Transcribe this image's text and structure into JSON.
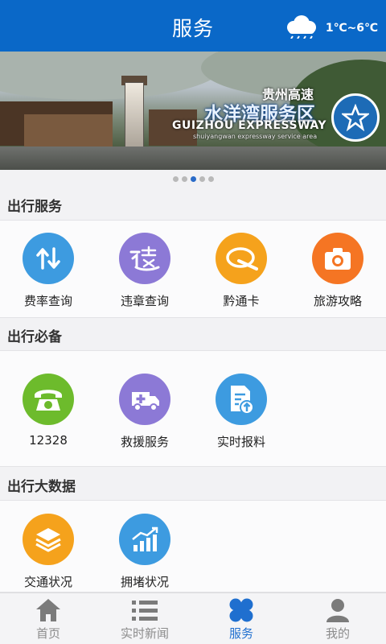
{
  "header": {
    "title": "服务",
    "weather_icon": "cloud-rain-icon",
    "temperature": "1℃~6℃"
  },
  "banner": {
    "line1": "贵州高速",
    "line2": "水洋湾服务区",
    "line3": "GUIZHOU EXPRESSWAY",
    "line4": "shuiyangwan expressway service area",
    "slide_index": 3,
    "slide_count": 5
  },
  "sections": [
    {
      "title": "出行服务",
      "items": [
        {
          "label": "费率查询",
          "icon": "swap-arrows-icon",
          "color": "#3d9be0"
        },
        {
          "label": "违章查询",
          "icon": "violation-icon",
          "color": "#8c79d6"
        },
        {
          "label": "黔通卡",
          "icon": "q-card-icon",
          "color": "#f5a21c"
        },
        {
          "label": "旅游攻略",
          "icon": "camera-icon",
          "color": "#f57523"
        }
      ]
    },
    {
      "title": "出行必备",
      "items": [
        {
          "label": "12328",
          "icon": "phone-icon",
          "color": "#6dbb2c"
        },
        {
          "label": "救援服务",
          "icon": "ambulance-icon",
          "color": "#8c79d6"
        },
        {
          "label": "实时报料",
          "icon": "report-upload-icon",
          "color": "#3d9be0"
        }
      ]
    },
    {
      "title": "出行大数据",
      "items": [
        {
          "label": "交通状况",
          "icon": "layers-icon",
          "color": "#f5a21c"
        },
        {
          "label": "拥堵状况",
          "icon": "bar-chart-icon",
          "color": "#3d9be0"
        }
      ]
    }
  ],
  "tabbar": [
    {
      "label": "首页",
      "icon": "home-icon",
      "active": false
    },
    {
      "label": "实时新闻",
      "icon": "list-icon",
      "active": false
    },
    {
      "label": "服务",
      "icon": "clover-icon",
      "active": true
    },
    {
      "label": "我的",
      "icon": "user-icon",
      "active": false
    }
  ],
  "colors": {
    "primary": "#0a68c8",
    "active_tab": "#1f6fcf",
    "inactive_tab": "#8c8c8c"
  }
}
